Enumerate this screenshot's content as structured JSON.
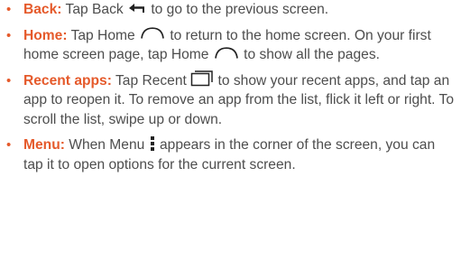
{
  "items": [
    {
      "term": "Back:",
      "before_icon": " Tap Back ",
      "icon": "back-arrow-icon",
      "after_icon": " to go to the previous screen."
    },
    {
      "term": "Home:",
      "before_icon": " Tap Home ",
      "icon": "home-icon",
      "after_icon": " to return to the home screen. On your first home screen page, tap Home ",
      "icon2": "home-icon",
      "after_icon2": " to show all the pages."
    },
    {
      "term": "Recent apps:",
      "before_icon": " Tap Recent ",
      "icon": "recent-apps-icon",
      "after_icon": " to show your recent apps, and tap an app to reopen it. To remove an app from the list, flick it left or right. To scroll the list, swipe up or down."
    },
    {
      "term": "Menu:",
      "before_icon": " When Menu ",
      "icon": "menu-dots-icon",
      "after_icon": " appears in the corner of the screen, you can tap it to open options for the current screen."
    }
  ],
  "colors": {
    "accent": "#e55a2b",
    "text": "#4d4d4d"
  },
  "bullet_glyph": "•"
}
